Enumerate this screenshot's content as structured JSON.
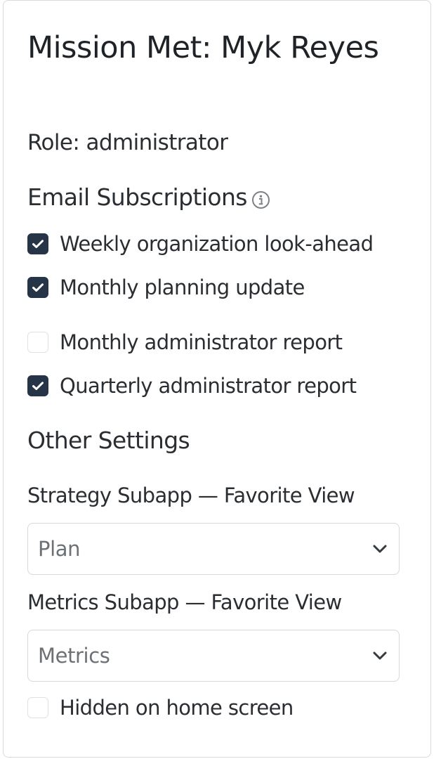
{
  "profile": {
    "title": "Mission Met: Myk Reyes",
    "role": "Role: administrator"
  },
  "email_subscriptions": {
    "heading": "Email Subscriptions",
    "info_icon": "info-circle-icon",
    "items": [
      {
        "label": "Weekly organization look-ahead",
        "checked": true
      },
      {
        "label": "Monthly planning update",
        "checked": true
      },
      {
        "label": "Monthly administrator report",
        "checked": false
      },
      {
        "label": "Quarterly administrator report",
        "checked": true
      }
    ]
  },
  "other_settings": {
    "heading": "Other Settings",
    "strategy_favorite": {
      "label": "Strategy Subapp — Favorite View",
      "value": "Plan"
    },
    "metrics_favorite": {
      "label": "Metrics Subapp — Favorite View",
      "value": "Metrics"
    },
    "hidden_on_home": {
      "label": "Hidden on home screen",
      "checked": false
    }
  },
  "colors": {
    "checkbox_checked": "#253447",
    "text": "#2a2e32",
    "border": "#d6d9dc"
  }
}
